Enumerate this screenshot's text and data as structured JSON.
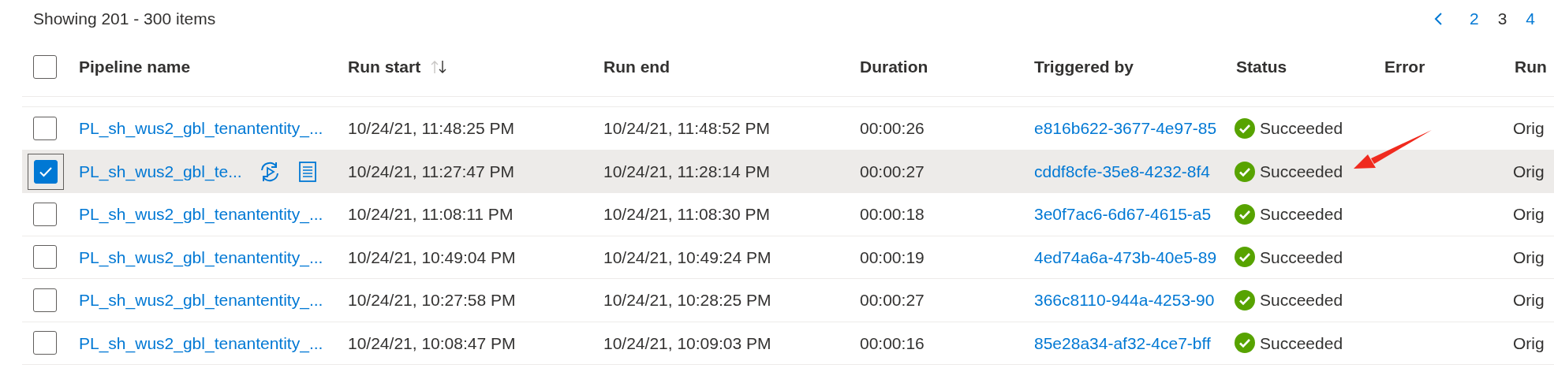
{
  "summary": "Showing 201 - 300 items",
  "pagination": {
    "pages": [
      {
        "label": "2",
        "selected": false
      },
      {
        "label": "3",
        "selected": true
      },
      {
        "label": "4",
        "selected": false
      }
    ]
  },
  "table": {
    "select_all": {
      "checked": false
    },
    "columns": [
      {
        "label": "Pipeline name",
        "sorted": false
      },
      {
        "label": "Run start",
        "sorted": true
      },
      {
        "label": "Run end",
        "sorted": false
      },
      {
        "label": "Duration",
        "sorted": false
      },
      {
        "label": "Triggered by",
        "sorted": false
      },
      {
        "label": "Status",
        "sorted": false
      },
      {
        "label": "Error",
        "sorted": false
      },
      {
        "label": "Run",
        "sorted": false
      }
    ],
    "rows": [
      {
        "selected": false,
        "pipeline_name": "PL_sh_wus2_gbl_tenantentity_...",
        "run_start": "10/24/21, 11:48:25 PM",
        "run_end": "10/24/21, 11:48:52 PM",
        "duration": "00:00:26",
        "triggered_by": "e816b622-3677-4e97-85",
        "status": "Succeeded",
        "run": "Orig"
      },
      {
        "selected": true,
        "pipeline_name": "PL_sh_wus2_gbl_te...",
        "run_start": "10/24/21, 11:27:47 PM",
        "run_end": "10/24/21, 11:28:14 PM",
        "duration": "00:00:27",
        "triggered_by": "cddf8cfe-35e8-4232-8f4",
        "status": "Succeeded",
        "run": "Orig"
      },
      {
        "selected": false,
        "pipeline_name": "PL_sh_wus2_gbl_tenantentity_...",
        "run_start": "10/24/21, 11:08:11 PM",
        "run_end": "10/24/21, 11:08:30 PM",
        "duration": "00:00:18",
        "triggered_by": "3e0f7ac6-6d67-4615-a5",
        "status": "Succeeded",
        "run": "Orig"
      },
      {
        "selected": false,
        "pipeline_name": "PL_sh_wus2_gbl_tenantentity_...",
        "run_start": "10/24/21, 10:49:04 PM",
        "run_end": "10/24/21, 10:49:24 PM",
        "duration": "00:00:19",
        "triggered_by": "4ed74a6a-473b-40e5-89",
        "status": "Succeeded",
        "run": "Orig"
      },
      {
        "selected": false,
        "pipeline_name": "PL_sh_wus2_gbl_tenantentity_...",
        "run_start": "10/24/21, 10:27:58 PM",
        "run_end": "10/24/21, 10:28:25 PM",
        "duration": "00:00:27",
        "triggered_by": "366c8110-944a-4253-90",
        "status": "Succeeded",
        "run": "Orig"
      },
      {
        "selected": false,
        "pipeline_name": "PL_sh_wus2_gbl_tenantentity_...",
        "run_start": "10/24/21, 10:08:47 PM",
        "run_end": "10/24/21, 10:09:03 PM",
        "duration": "00:00:16",
        "triggered_by": "85e28a34-af32-4ce7-bff",
        "status": "Succeeded",
        "run": "Orig"
      }
    ]
  }
}
